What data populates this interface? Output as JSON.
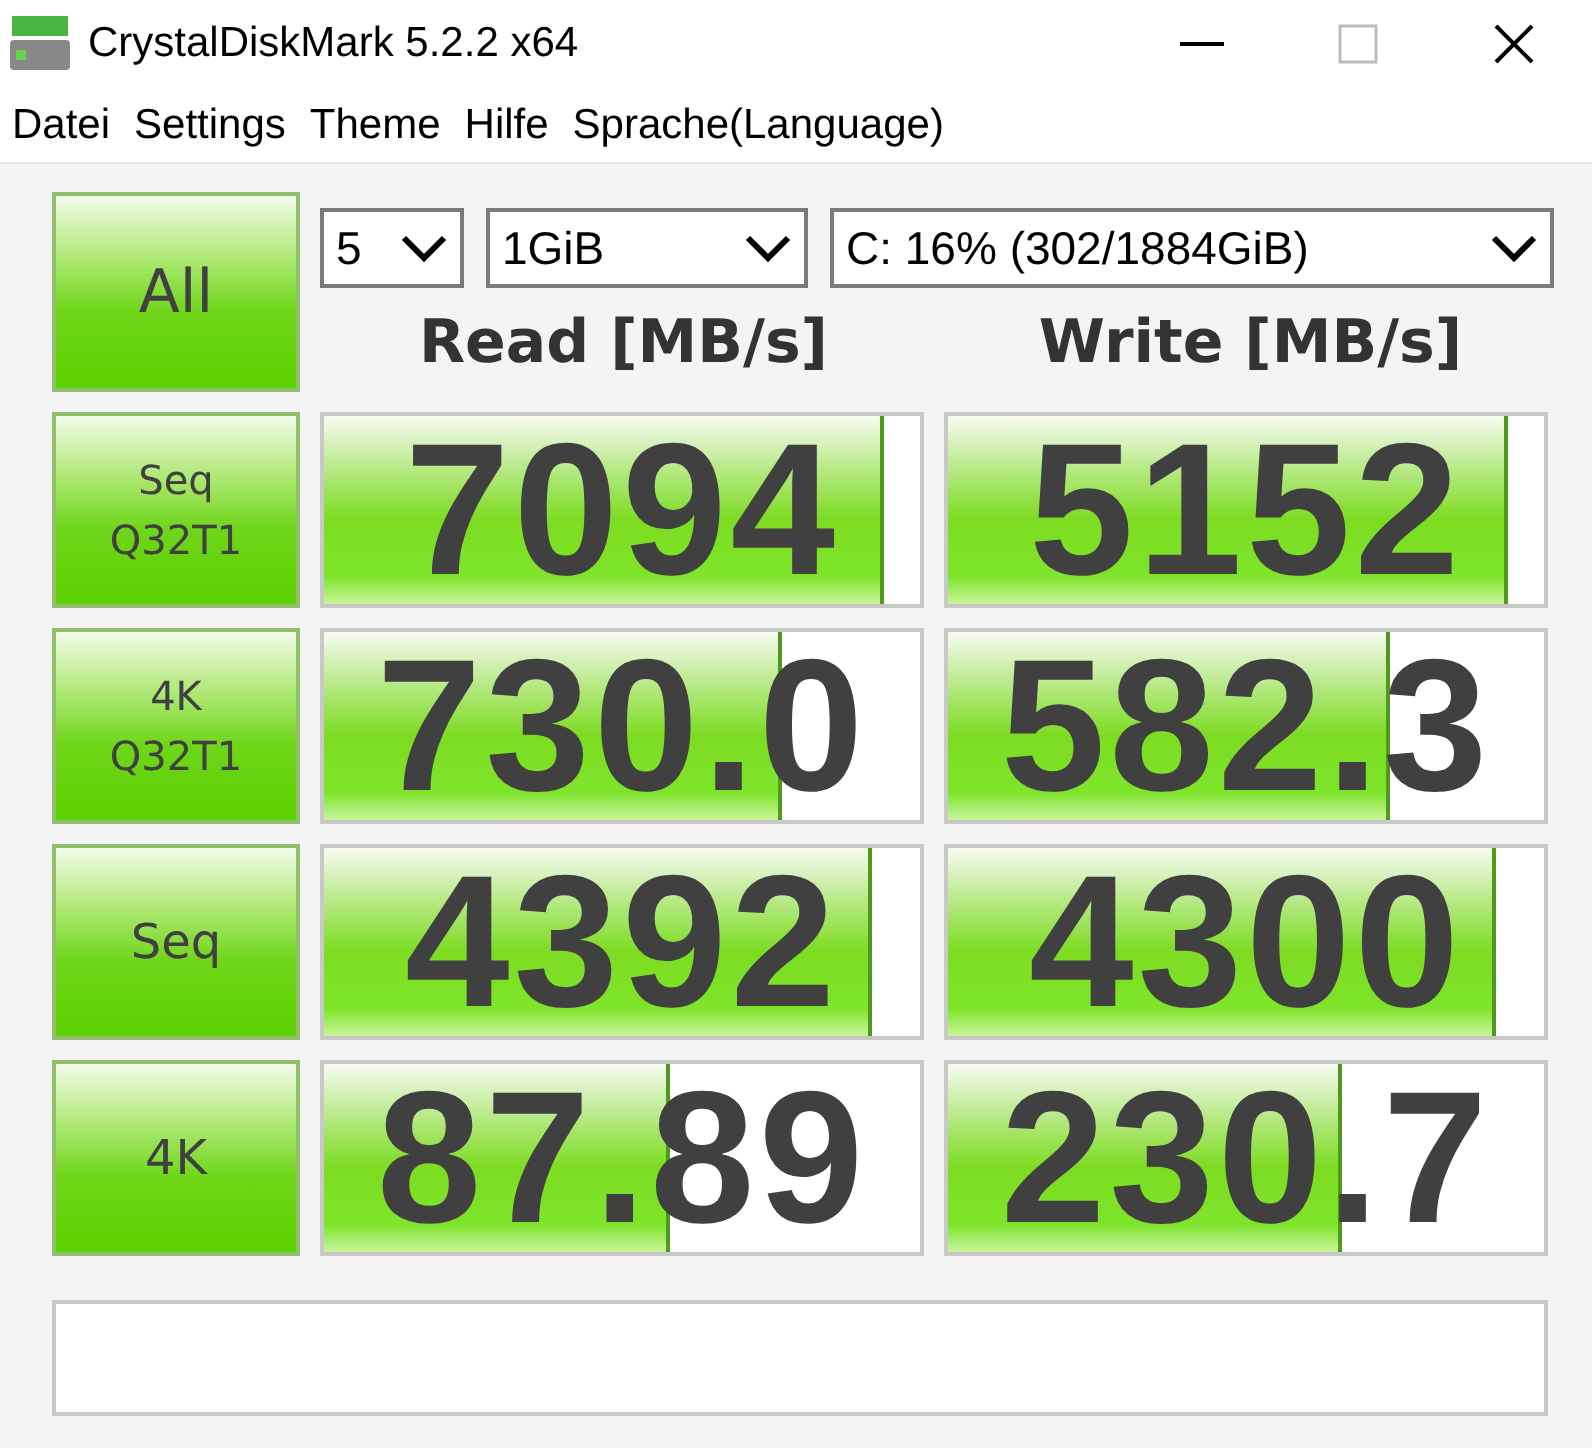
{
  "window": {
    "title": "CrystalDiskMark 5.2.2 x64"
  },
  "menu": [
    "Datei",
    "Settings",
    "Theme",
    "Hilfe",
    "Sprache(Language)"
  ],
  "all_button": "All",
  "selects": [
    {
      "value": "5"
    },
    {
      "value": "1GiB"
    },
    {
      "value": "C: 16% (302/1884GiB)"
    }
  ],
  "columns": [
    "Read [MB/s]",
    "Write [MB/s]"
  ],
  "rows": [
    {
      "label": [
        "Seq",
        "Q32T1"
      ],
      "read": {
        "value": "7094",
        "level": 0.94
      },
      "write": {
        "value": "5152",
        "level": 0.94
      }
    },
    {
      "label": [
        "4K",
        "Q32T1"
      ],
      "read": {
        "value": "730.0",
        "level": 0.77
      },
      "write": {
        "value": "582.3",
        "level": 0.74
      }
    },
    {
      "label": [
        "Seq"
      ],
      "read": {
        "value": "4392",
        "level": 0.92
      },
      "write": {
        "value": "4300",
        "level": 0.92
      }
    },
    {
      "label": [
        "4K"
      ],
      "read": {
        "value": "87.89",
        "level": 0.58
      },
      "write": {
        "value": "230.7",
        "level": 0.66
      }
    }
  ]
}
